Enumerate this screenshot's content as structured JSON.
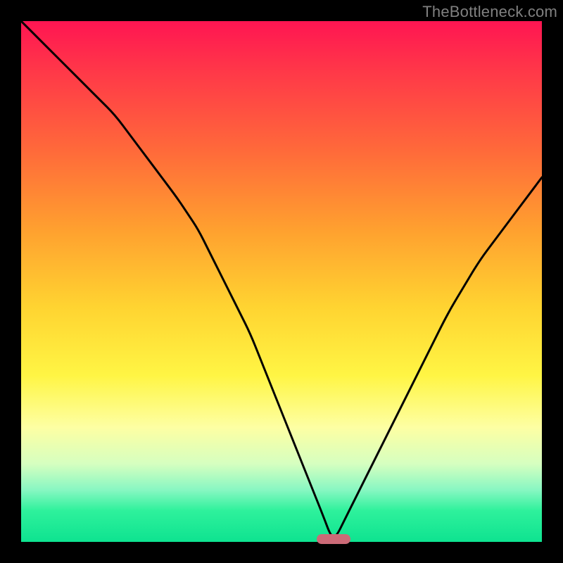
{
  "watermark": "TheBottleneck.com",
  "chart_data": {
    "type": "line",
    "title": "",
    "xlabel": "",
    "ylabel": "",
    "xlim": [
      0,
      100
    ],
    "ylim": [
      0,
      100
    ],
    "series": [
      {
        "name": "bottleneck-curve",
        "x": [
          0,
          3,
          6,
          9,
          12,
          15,
          18,
          21,
          24,
          27,
          30,
          32,
          34,
          36,
          38,
          40,
          42,
          44,
          46,
          48,
          50,
          52,
          54,
          56,
          58,
          59.5,
          60.5,
          62,
          64,
          67,
          70,
          73,
          76,
          79,
          82,
          85,
          88,
          91,
          94,
          97,
          100
        ],
        "values": [
          100,
          97,
          94,
          91,
          88,
          85,
          82,
          78,
          74,
          70,
          66,
          63,
          60,
          56,
          52,
          48,
          44,
          40,
          35,
          30,
          25,
          20,
          15,
          10,
          5,
          1,
          1,
          4,
          8,
          14,
          20,
          26,
          32,
          38,
          44,
          49,
          54,
          58,
          62,
          66,
          70
        ]
      }
    ],
    "marker": {
      "x": 60,
      "y": 0.5,
      "label": "optimal-point"
    }
  },
  "colors": {
    "curve": "#000000",
    "marker": "#cc6a77",
    "background_top": "#ff1552",
    "background_bottom": "#0ee390",
    "frame": "#000000",
    "watermark": "#808080"
  }
}
